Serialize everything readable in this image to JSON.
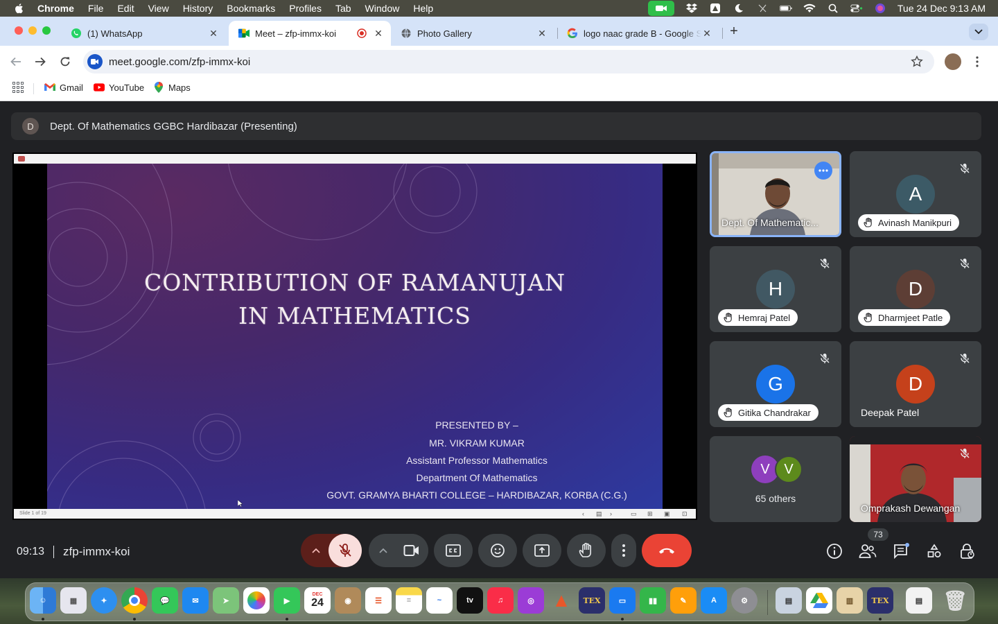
{
  "menubar": {
    "app_name": "Chrome",
    "items": [
      "File",
      "Edit",
      "View",
      "History",
      "Bookmarks",
      "Profiles",
      "Tab",
      "Window",
      "Help"
    ],
    "clock": "Tue 24 Dec  9:13 AM"
  },
  "tabs": [
    {
      "title": "(1) WhatsApp",
      "icon": "whatsapp-icon"
    },
    {
      "title": "Meet – zfp-immx-koi",
      "icon": "google-meet-icon",
      "active": true
    },
    {
      "title": "Photo Gallery",
      "icon": "globe-icon"
    },
    {
      "title": "logo naac grade B - Google S",
      "icon": "google-icon"
    }
  ],
  "toolbar": {
    "url": "meet.google.com/zfp-immx-koi"
  },
  "bookmarks": [
    {
      "label": "Gmail",
      "icon": "gmail-icon"
    },
    {
      "label": "YouTube",
      "icon": "youtube-icon"
    },
    {
      "label": "Maps",
      "icon": "maps-icon"
    }
  ],
  "meet": {
    "presenting": {
      "avatar_letter": "D",
      "label": "Dept. Of Mathematics GGBC Hardibazar (Presenting)"
    },
    "slide": {
      "title_line1": "CONTRIBUTION OF RAMANUJAN",
      "title_line2": "IN MATHEMATICS",
      "credits": [
        "PRESENTED BY –",
        "MR. VIKRAM KUMAR",
        "Assistant Professor Mathematics",
        "Department Of Mathematics",
        "GOVT. GRAMYA BHARTI COLLEGE – HARDIBAZAR, KORBA (C.G.)"
      ],
      "slide_counter": "Slide 1 of 19"
    },
    "participants": [
      {
        "name": "Dept. Of Mathematic...",
        "type": "video"
      },
      {
        "name": "Avinash Manikpuri",
        "letter": "A",
        "color": "#3c5a66"
      },
      {
        "name": "Hemraj Patel",
        "letter": "H",
        "color": "#415863"
      },
      {
        "name": "Dharmjeet Patle",
        "letter": "D",
        "color": "#5d3e35"
      },
      {
        "name": "Gitika Chandrakar",
        "letter": "G",
        "color": "#1a73e8"
      },
      {
        "name": "Deepak Patel",
        "letter": "D",
        "color": "#c5411b"
      },
      {
        "name": "Omprakash Dewangan",
        "type": "video"
      }
    ],
    "others": {
      "letters": [
        "V",
        "V"
      ],
      "colors": [
        "#8e3fbd",
        "#5d8a1c"
      ],
      "label": "65 others"
    },
    "meeting_time": "09:13",
    "meeting_code": "zfp-immx-koi",
    "people_count": "73",
    "colors": {
      "end_call": "#ea4335",
      "mic_off": "#f9dedc",
      "speaker_border": "#8ab4f8"
    }
  }
}
